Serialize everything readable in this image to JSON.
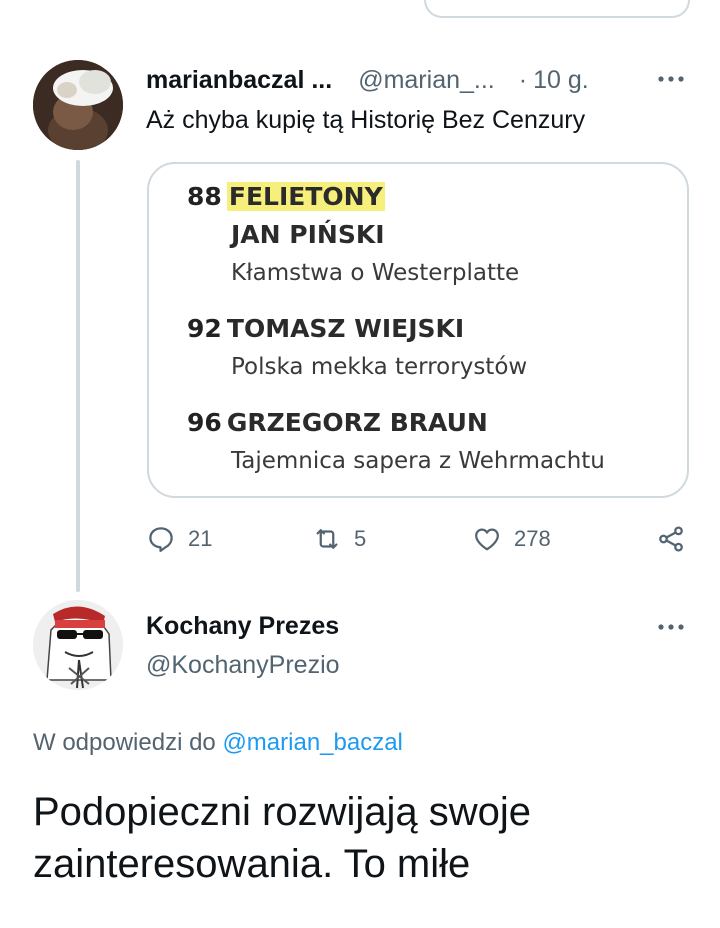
{
  "tweet1": {
    "display_name": "marianbaczal ...",
    "handle": "@marian_...",
    "separator": "·",
    "time": "10 g.",
    "text": "Aż chyba kupię tą Historię Bez Cenzury",
    "media": {
      "entries": [
        {
          "number": "88",
          "section": "FELIETONY",
          "author": "JAN PIŃSKI",
          "title": "Kłamstwa o Westerplatte"
        },
        {
          "number": "92",
          "author": "TOMASZ WIEJSKI",
          "title": "Polska mekka terrorystów"
        },
        {
          "number": "96",
          "author": "GRZEGORZ BRAUN",
          "title": "Tajemnica sapera z Wehrmachtu"
        }
      ]
    },
    "actions": {
      "replies": "21",
      "retweets": "5",
      "likes": "278"
    }
  },
  "tweet2": {
    "display_name": "Kochany Prezes",
    "handle": "@KochanyPrezio",
    "reply_prefix": "W odpowiedzi do",
    "reply_target": "@marian_baczal",
    "text": "Podopieczni rozwijają swoje zainteresowania. To miłe"
  },
  "icons": {
    "more": "more-horizontal-icon",
    "reply": "comment-icon",
    "retweet": "retweet-icon",
    "like": "heart-icon",
    "share": "share-icon"
  },
  "colors": {
    "text": "#0f1419",
    "muted": "#536471",
    "link": "#1d9bf0",
    "border": "#cfd9de",
    "highlight": "#f7ef7b"
  }
}
